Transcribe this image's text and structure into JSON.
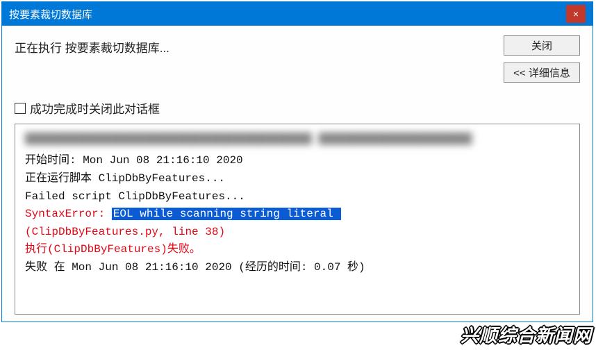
{
  "titlebar": {
    "title": "按要素裁切数据库",
    "close_icon": "×"
  },
  "dialog": {
    "status_text": "正在执行 按要素裁切数据库...",
    "close_button": "关闭",
    "details_button": "<< 详细信息",
    "checkbox_label": "成功完成时关闭此对话框"
  },
  "log": {
    "blurred": "███████████████████████████████████████████\n███████████████████████",
    "lines": [
      {
        "text": "开始时间: Mon Jun 08 21:16:10 2020",
        "cls": ""
      },
      {
        "text": "正在运行脚本 ClipDbByFeatures...",
        "cls": ""
      },
      {
        "text": "Failed script ClipDbByFeatures...",
        "cls": ""
      },
      {
        "prefix": "SyntaxError: ",
        "hl": "EOL while scanning string literal ",
        "cls": "red"
      },
      {
        "text": "(ClipDbByFeatures.py, line 38)",
        "cls": "red"
      },
      {
        "text": "执行(ClipDbByFeatures)失败。",
        "cls": "red"
      },
      {
        "text": "失败 在 Mon Jun 08 21:16:10 2020 (经历的时间: 0.07 秒)",
        "cls": ""
      }
    ]
  },
  "watermark": "兴顺综合新闻网"
}
